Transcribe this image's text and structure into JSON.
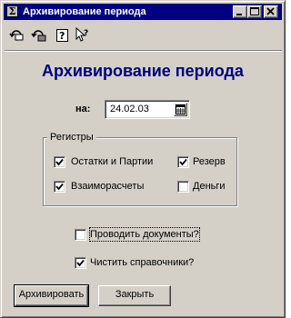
{
  "window": {
    "title": "Архивирование периода",
    "icon": "sigma-icon",
    "controls": [
      "minimize-icon",
      "maximize-icon",
      "close-icon"
    ]
  },
  "toolbar": {
    "items": [
      "restore-icon",
      "save-icon",
      "help-icon",
      "whats-this-icon"
    ]
  },
  "form": {
    "heading": "Архивирование периода",
    "date_label": "на:",
    "date_value": "24.02.03"
  },
  "registers": {
    "legend": "Регистры",
    "items": [
      {
        "label": "Остатки и Партии",
        "checked": true
      },
      {
        "label": "Резерв",
        "checked": true
      },
      {
        "label": "Взаиморасчеты",
        "checked": true
      },
      {
        "label": "Деньги",
        "checked": false
      }
    ]
  },
  "options": {
    "post_documents": {
      "label": "Проводить документы?",
      "checked": false
    },
    "clean_catalogs": {
      "label": "Чистить справочники?",
      "checked": true
    }
  },
  "buttons": {
    "archive": "Архивировать",
    "close": "Закрыть"
  },
  "colors": {
    "titlebar": "#000080",
    "heading": "#000080",
    "face": "#d4d0c8"
  }
}
